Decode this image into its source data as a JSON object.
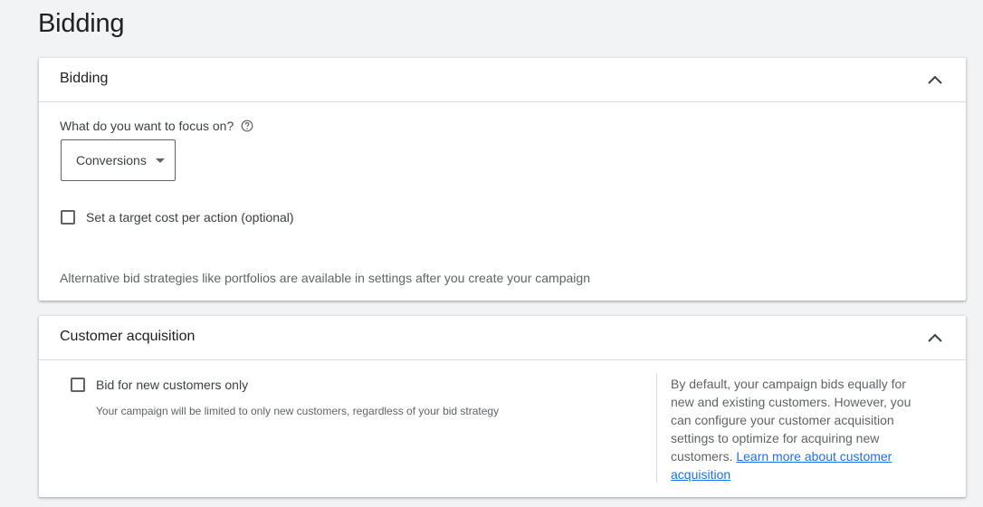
{
  "page": {
    "title": "Bidding"
  },
  "bidding_card": {
    "title": "Bidding",
    "focus_label": "What do you want to focus on?",
    "focus_select_value": "Conversions",
    "target_cpa_label": "Set a target cost per action (optional)",
    "target_cpa_checked": false,
    "alt_strategies_note": "Alternative bid strategies like portfolios are available in settings after you create your campaign"
  },
  "customer_card": {
    "title": "Customer acquisition",
    "new_customers_label": "Bid for new customers only",
    "new_customers_checked": false,
    "new_customers_help": "Your campaign will be limited to only new customers, regardless of your bid strategy",
    "info_text": "By default, your campaign bids equally for new and existing customers. However, you can configure your customer acquisition settings to optimize for acquiring new customers. ",
    "info_link": "Learn more about customer acquisition"
  },
  "icons": {
    "collapse": "chevron-up-icon",
    "help": "help-circle-icon",
    "dropdown": "arrow-drop-down-icon"
  },
  "colors": {
    "background": "#f1f3f4",
    "link": "#1a73e8",
    "divider": "#dadce0"
  }
}
